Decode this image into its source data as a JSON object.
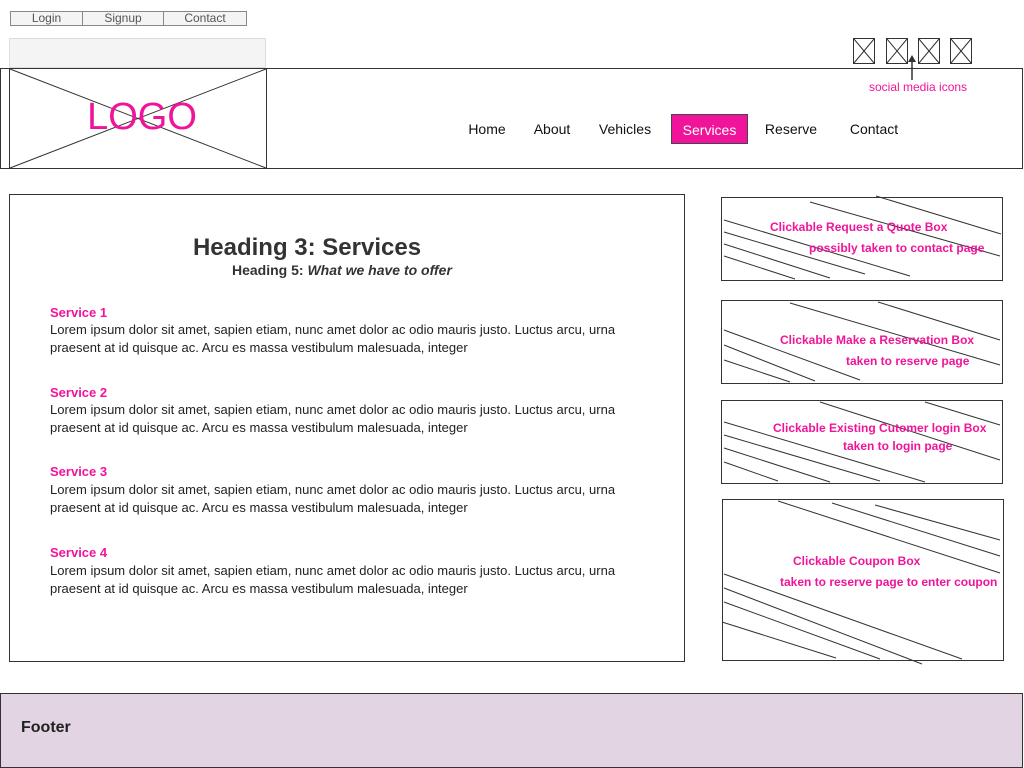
{
  "utility_nav": {
    "login": "Login",
    "signup": "Signup",
    "contact": "Contact"
  },
  "logo": {
    "text": "LOGO"
  },
  "nav": {
    "items": [
      "Home",
      "About",
      "Vehicles",
      "Services",
      "Reserve",
      "Contact"
    ],
    "active": "Services"
  },
  "social": {
    "label": "social media icons"
  },
  "main": {
    "heading3": "Heading 3: Services",
    "heading5_prefix": "Heading 5:",
    "heading5_italic": "What we have to offer",
    "services": [
      {
        "title": "Service 1",
        "body": "Lorem ipsum dolor sit amet, sapien etiam, nunc amet dolor ac odio mauris justo. Luctus arcu, urna praesent at id quisque ac. Arcu es massa vestibulum malesuada, integer"
      },
      {
        "title": "Service 2",
        "body": "Lorem ipsum dolor sit amet, sapien etiam, nunc amet dolor ac odio mauris justo. Luctus arcu, urna praesent at id quisque ac. Arcu es massa vestibulum malesuada, integer"
      },
      {
        "title": "Service 3",
        "body": "Lorem ipsum dolor sit amet, sapien etiam, nunc amet dolor ac odio mauris justo. Luctus arcu, urna praesent at id quisque ac. Arcu es massa vestibulum malesuada, integer"
      },
      {
        "title": "Service 4",
        "body": "Lorem ipsum dolor sit amet, sapien etiam, nunc amet dolor ac odio mauris justo. Luctus arcu, urna praesent at id quisque ac. Arcu es massa vestibulum malesuada, integer"
      }
    ]
  },
  "sidebar": {
    "quote": {
      "line1": "Clickable Request a Quote Box",
      "line2": "possibly taken to contact page"
    },
    "reservation": {
      "line1": "Clickable Make a Reservation Box",
      "line2": "taken to reserve page"
    },
    "login": {
      "line1": "Clickable Existing Cutomer login Box",
      "line2": "taken to login page"
    },
    "coupon": {
      "line1": "Clickable Coupon Box",
      "line2": "taken to reserve page to enter coupon"
    }
  },
  "footer": {
    "label": "Footer"
  },
  "colors": {
    "accent": "#f0149a",
    "footer_bg": "#e2d4e2",
    "border": "#333333"
  }
}
